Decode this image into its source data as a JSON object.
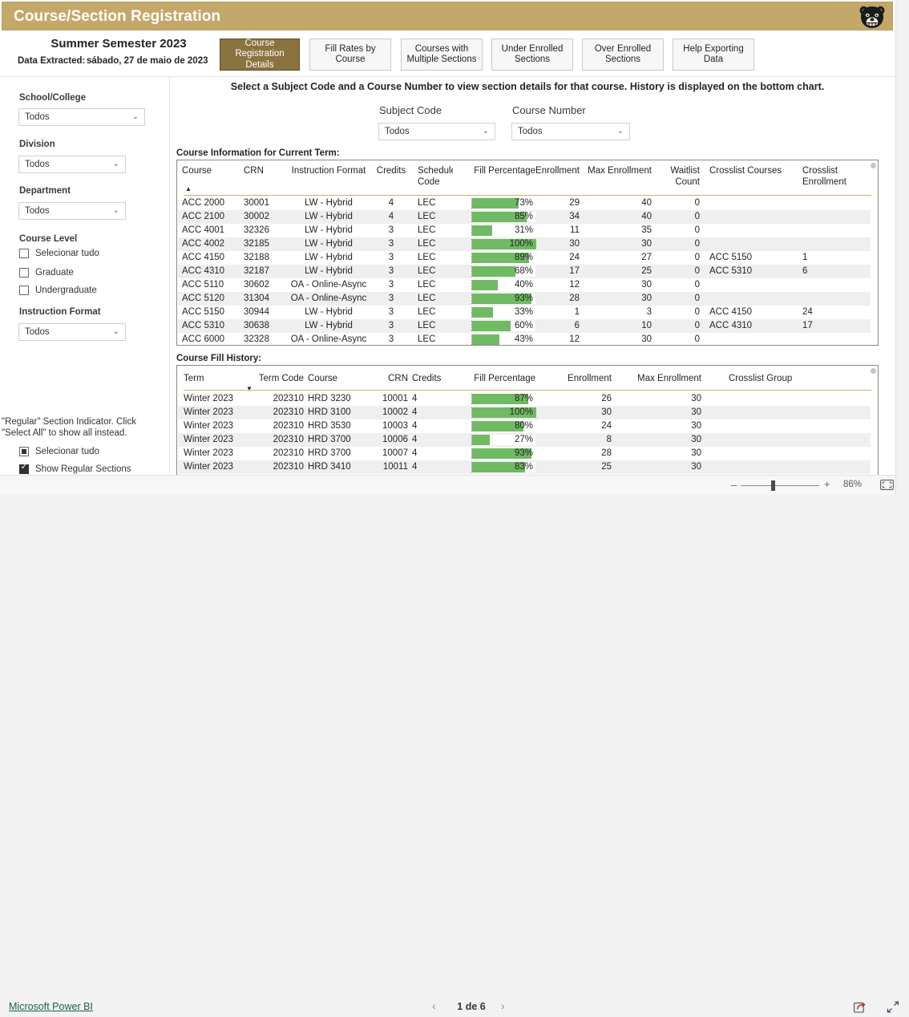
{
  "header": {
    "title": "Course/Section Registration",
    "logo_icon": "grizzly-bear-logo",
    "band_color": "#c4a86a",
    "semester": "Summer Semester 2023",
    "extract_label": "Data Extracted:",
    "extract_value": "sábado, 27 de maio de 2023"
  },
  "nav_tabs": [
    {
      "label": "Course Registration Details",
      "active": true
    },
    {
      "label": "Fill Rates by Course",
      "active": false
    },
    {
      "label": "Courses with Multiple Sections",
      "active": false
    },
    {
      "label": "Under Enrolled Sections",
      "active": false
    },
    {
      "label": "Over Enrolled Sections",
      "active": false
    },
    {
      "label": "Help Exporting Data",
      "active": false
    }
  ],
  "filters": {
    "school_label": "School/College",
    "school_value": "Todos",
    "division_label": "Division",
    "division_value": "Todos",
    "department_label": "Department",
    "department_value": "Todos",
    "course_level_label": "Course Level",
    "course_level_options": [
      {
        "label": "Selecionar tudo",
        "state": "unchecked"
      },
      {
        "label": "Graduate",
        "state": "unchecked"
      },
      {
        "label": "Undergraduate",
        "state": "unchecked"
      }
    ],
    "instruction_format_label": "Instruction Format",
    "instruction_format_value": "Todos",
    "regular_note": "\"Regular\" Section Indicator. Click \"Select All\" to show all instead.",
    "regular_options": [
      {
        "label": "Selecionar tudo",
        "state": "partial"
      },
      {
        "label": "Show Regular Sections",
        "state": "checked"
      }
    ]
  },
  "main": {
    "instruction": "Select a Subject Code and a Course Number to view section details for that course. History is displayed on the bottom chart.",
    "subject_code_label": "Subject Code",
    "subject_code_value": "Todos",
    "course_number_label": "Course Number",
    "course_number_value": "Todos",
    "top_caption": "Course Information for Current Term:",
    "bottom_caption": "Course Fill History:"
  },
  "chart_data": [
    {
      "type": "table",
      "title": "Course Information for Current Term:",
      "sort_column": "Course",
      "sort_direction": "asc",
      "columns": [
        "Course",
        "CRN",
        "Instruction Format",
        "Credits",
        "Schedule Code",
        "Fill Percentage",
        "Enrollment",
        "Max Enrollment",
        "Waitlist Count",
        "Crosslist Courses",
        "Crosslist Enrollment"
      ],
      "rows": [
        {
          "course": "ACC 2000",
          "crn": "30001",
          "format": "LW - Hybrid",
          "credits": "4",
          "sched": "LEC",
          "fill": 73,
          "fill_label": "73%",
          "enrollment": "29",
          "max": "40",
          "waitlist": "0",
          "crosslist": "",
          "cl_enroll": ""
        },
        {
          "course": "ACC 2100",
          "crn": "30002",
          "format": "LW - Hybrid",
          "credits": "4",
          "sched": "LEC",
          "fill": 85,
          "fill_label": "85%",
          "enrollment": "34",
          "max": "40",
          "waitlist": "0",
          "crosslist": "",
          "cl_enroll": ""
        },
        {
          "course": "ACC 4001",
          "crn": "32326",
          "format": "LW - Hybrid",
          "credits": "3",
          "sched": "LEC",
          "fill": 31,
          "fill_label": "31%",
          "enrollment": "11",
          "max": "35",
          "waitlist": "0",
          "crosslist": "",
          "cl_enroll": ""
        },
        {
          "course": "ACC 4002",
          "crn": "32185",
          "format": "LW - Hybrid",
          "credits": "3",
          "sched": "LEC",
          "fill": 100,
          "fill_label": "100%",
          "enrollment": "30",
          "max": "30",
          "waitlist": "0",
          "crosslist": "",
          "cl_enroll": ""
        },
        {
          "course": "ACC 4150",
          "crn": "32188",
          "format": "LW - Hybrid",
          "credits": "3",
          "sched": "LEC",
          "fill": 89,
          "fill_label": "89%",
          "enrollment": "24",
          "max": "27",
          "waitlist": "0",
          "crosslist": "ACC 5150",
          "cl_enroll": "1"
        },
        {
          "course": "ACC 4310",
          "crn": "32187",
          "format": "LW - Hybrid",
          "credits": "3",
          "sched": "LEC",
          "fill": 68,
          "fill_label": "68%",
          "enrollment": "17",
          "max": "25",
          "waitlist": "0",
          "crosslist": "ACC 5310",
          "cl_enroll": "6"
        },
        {
          "course": "ACC 5110",
          "crn": "30602",
          "format": "OA - Online-Async",
          "credits": "3",
          "sched": "LEC",
          "fill": 40,
          "fill_label": "40%",
          "enrollment": "12",
          "max": "30",
          "waitlist": "0",
          "crosslist": "",
          "cl_enroll": ""
        },
        {
          "course": "ACC 5120",
          "crn": "31304",
          "format": "OA - Online-Async",
          "credits": "3",
          "sched": "LEC",
          "fill": 93,
          "fill_label": "93%",
          "enrollment": "28",
          "max": "30",
          "waitlist": "0",
          "crosslist": "",
          "cl_enroll": ""
        },
        {
          "course": "ACC 5150",
          "crn": "30944",
          "format": "LW - Hybrid",
          "credits": "3",
          "sched": "LEC",
          "fill": 33,
          "fill_label": "33%",
          "enrollment": "1",
          "max": "3",
          "waitlist": "0",
          "crosslist": "ACC 4150",
          "cl_enroll": "24"
        },
        {
          "course": "ACC 5310",
          "crn": "30638",
          "format": "LW - Hybrid",
          "credits": "3",
          "sched": "LEC",
          "fill": 60,
          "fill_label": "60%",
          "enrollment": "6",
          "max": "10",
          "waitlist": "0",
          "crosslist": "ACC 4310",
          "cl_enroll": "17"
        },
        {
          "course": "ACC 6000",
          "crn": "32328",
          "format": "OA - Online-Async",
          "credits": "3",
          "sched": "LEC",
          "fill": 43,
          "fill_label": "43%",
          "enrollment": "12",
          "max": "30",
          "waitlist": "0",
          "crosslist": "",
          "cl_enroll": ""
        }
      ]
    },
    {
      "type": "table",
      "title": "Course Fill History:",
      "sort_column": "Term Code",
      "sort_direction": "desc",
      "columns": [
        "Term",
        "Term Code",
        "Course",
        "CRN",
        "Credits",
        "Fill Percentage",
        "Enrollment",
        "Max Enrollment",
        "Crosslist Group"
      ],
      "rows": [
        {
          "term": "Winter 2023",
          "term_code": "202310",
          "course": "HRD 3230",
          "crn": "10001",
          "credits": "4",
          "fill": 87,
          "fill_label": "87%",
          "enrollment": "26",
          "max": "30",
          "group": ""
        },
        {
          "term": "Winter 2023",
          "term_code": "202310",
          "course": "HRD 3100",
          "crn": "10002",
          "credits": "4",
          "fill": 100,
          "fill_label": "100%",
          "enrollment": "30",
          "max": "30",
          "group": ""
        },
        {
          "term": "Winter 2023",
          "term_code": "202310",
          "course": "HRD 3530",
          "crn": "10003",
          "credits": "4",
          "fill": 80,
          "fill_label": "80%",
          "enrollment": "24",
          "max": "30",
          "group": ""
        },
        {
          "term": "Winter 2023",
          "term_code": "202310",
          "course": "HRD 3700",
          "crn": "10006",
          "credits": "4",
          "fill": 27,
          "fill_label": "27%",
          "enrollment": "8",
          "max": "30",
          "group": ""
        },
        {
          "term": "Winter 2023",
          "term_code": "202310",
          "course": "HRD 3700",
          "crn": "10007",
          "credits": "4",
          "fill": 93,
          "fill_label": "93%",
          "enrollment": "28",
          "max": "30",
          "group": ""
        },
        {
          "term": "Winter 2023",
          "term_code": "202310",
          "course": "HRD 3410",
          "crn": "10011",
          "credits": "4",
          "fill": 83,
          "fill_label": "83%",
          "enrollment": "25",
          "max": "30",
          "group": ""
        }
      ]
    }
  ],
  "statusbar": {
    "zoom_minus": "–",
    "zoom_plus": "+",
    "zoom_level": "86%",
    "fit_icon": "fit-to-page-icon"
  },
  "footer": {
    "brand": "Microsoft Power BI",
    "prev_icon": "chevron-left-icon",
    "page_label": "1 de 6",
    "next_icon": "chevron-right-icon",
    "share_icon": "share-icon",
    "fullscreen_icon": "fullscreen-icon"
  },
  "colors": {
    "accent": "#c4a86a",
    "bar": "#6fba62",
    "active_tab": "#8b7340",
    "link": "#1b5e4b"
  }
}
